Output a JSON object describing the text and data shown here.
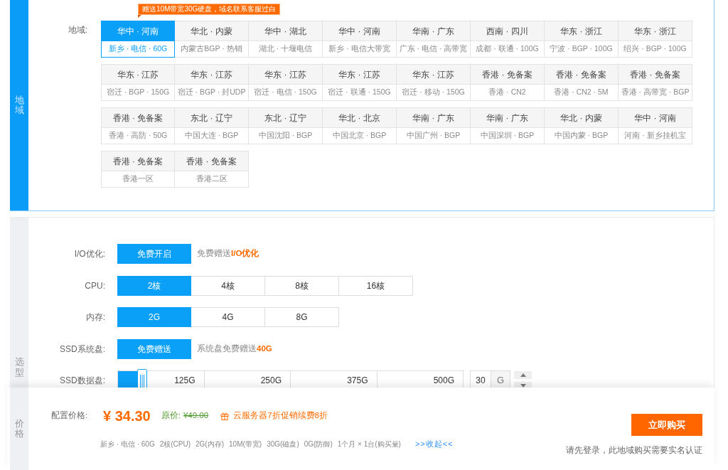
{
  "region_section": {
    "side_label": "地域",
    "promo_tag": "赠送10M带宽30G硬盘，域名联系客服过白",
    "label": "地域:",
    "regions": [
      {
        "area": "华中 · 河南",
        "detail": "新乡 · 电信 · 60G",
        "selected": true
      },
      {
        "area": "华北 · 内蒙",
        "detail": "内蒙古BGP · 热销",
        "selected": false
      },
      {
        "area": "华中 · 湖北",
        "detail": "湖北 · 十堰电信",
        "selected": false
      },
      {
        "area": "华中 · 河南",
        "detail": "新乡 · 电信大带宽",
        "selected": false
      },
      {
        "area": "华南 · 广东",
        "detail": "广东 · 电信 · 高带宽",
        "selected": false
      },
      {
        "area": "西南 · 四川",
        "detail": "成都 · 联通 · 100G",
        "selected": false
      },
      {
        "area": "华东 · 浙江",
        "detail": "宁波 · BGP · 100G",
        "selected": false
      },
      {
        "area": "华东 · 浙江",
        "detail": "绍兴 · BGP · 100G",
        "selected": false
      },
      {
        "area": "华东 · 江苏",
        "detail": "宿迁 · BGP · 150G",
        "selected": false
      },
      {
        "area": "华东 · 江苏",
        "detail": "宿迁 · BGP · 封UDP",
        "selected": false
      },
      {
        "area": "华东 · 江苏",
        "detail": "宿迁 · 电信 · 150G",
        "selected": false
      },
      {
        "area": "华东 · 江苏",
        "detail": "宿迁 · 联通 · 150G",
        "selected": false
      },
      {
        "area": "华东 · 江苏",
        "detail": "宿迁 · 移动 · 150G",
        "selected": false
      },
      {
        "area": "香港 · 免备案",
        "detail": "香港 · CN2",
        "selected": false
      },
      {
        "area": "香港 · 免备案",
        "detail": "香港 · CN2 · 5M",
        "selected": false
      },
      {
        "area": "香港 · 免备案",
        "detail": "香港 · 高带宽 · BGP",
        "selected": false
      },
      {
        "area": "香港 · 免备案",
        "detail": "香港 · 高防 · 50G",
        "selected": false
      },
      {
        "area": "东北 · 辽宁",
        "detail": "中国大连 · BGP",
        "selected": false
      },
      {
        "area": "东北 · 辽宁",
        "detail": "中国沈阳 · BGP",
        "selected": false
      },
      {
        "area": "华北 · 北京",
        "detail": "中国北京 · BGP",
        "selected": false
      },
      {
        "area": "华南 · 广东",
        "detail": "中国广州 · BGP",
        "selected": false
      },
      {
        "area": "华南 · 广东",
        "detail": "中国深圳 · BGP",
        "selected": false
      },
      {
        "area": "华北 · 内蒙",
        "detail": "中国内蒙 · BGP",
        "selected": false
      },
      {
        "area": "华中 · 河南",
        "detail": "河南 · 新乡挂机宝",
        "selected": false
      },
      {
        "area": "香港 · 免备案",
        "detail": "香港一区",
        "selected": false
      },
      {
        "area": "香港 · 免备案",
        "detail": "香港二区",
        "selected": false
      }
    ]
  },
  "config_section": {
    "side_label": "选型",
    "rows": [
      {
        "kind": "options",
        "label": "I/O优化:",
        "options": [
          {
            "text": "免费开启",
            "selected": true
          }
        ],
        "note": "免费赠送**I/O优化**"
      },
      {
        "kind": "options",
        "label": "CPU:",
        "options": [
          {
            "text": "2核",
            "selected": true
          },
          {
            "text": "4核",
            "selected": false
          },
          {
            "text": "8核",
            "selected": false
          },
          {
            "text": "16核",
            "selected": false
          }
        ]
      },
      {
        "kind": "options",
        "label": "内存:",
        "options": [
          {
            "text": "2G",
            "selected": true
          },
          {
            "text": "4G",
            "selected": false
          },
          {
            "text": "8G",
            "selected": false
          }
        ]
      },
      {
        "kind": "options",
        "label": "SSD系统盘:",
        "options": [
          {
            "text": "免费赠送",
            "selected": true
          }
        ],
        "note": "系统盘免费赠送**40G**"
      },
      {
        "kind": "slider",
        "label": "SSD数据盘:",
        "level": 0.07,
        "scale": [
          "125G",
          "250G",
          "375G",
          "500G"
        ],
        "value": "30",
        "unit": "G"
      }
    ]
  },
  "price_bar": {
    "side_label": "价格",
    "label": "配置价格:",
    "price": "¥ 34.30",
    "original_label": "原价:",
    "original_price": "¥49.00",
    "promo": "云服务器7折促销续费8折",
    "summary": [
      "新乡 · 电信 · 60G",
      "2核(CPU)",
      "2G(内存)",
      "10M(带宽)",
      "30G(磁盘)",
      "0G(防御)",
      "1个月 × 1台(购买量)"
    ],
    "toggle": ">>收起<<",
    "buy_button": "立即购买",
    "notice": "请先登录，此地域购买需要实名认证"
  }
}
